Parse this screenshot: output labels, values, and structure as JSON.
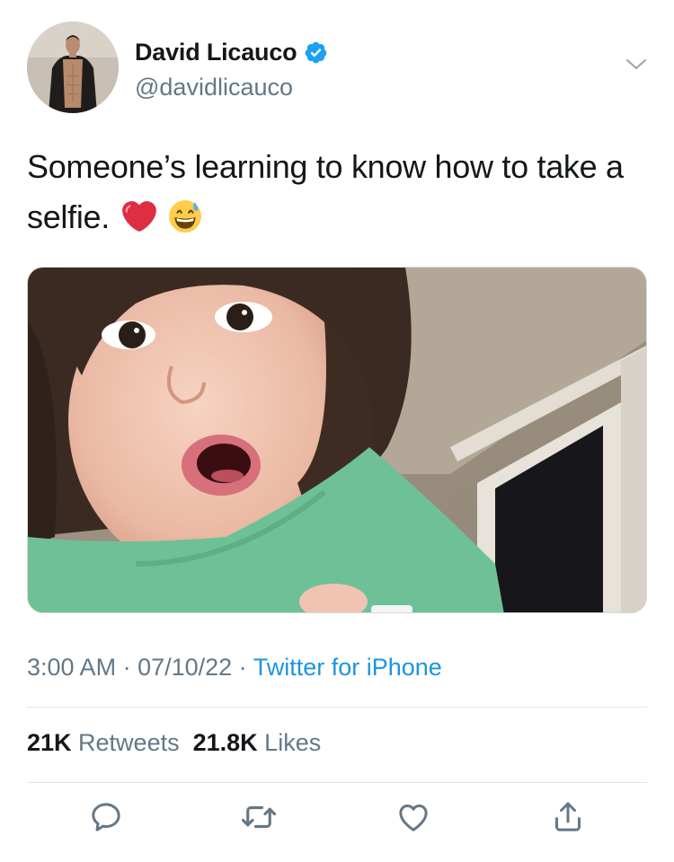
{
  "user": {
    "display_name": "David Licauco",
    "handle": "@davidlicauco",
    "verified": true
  },
  "tweet": {
    "text": "Someone’s learning to know how to take a selfie.",
    "emojis": [
      "red-heart",
      "grinning-face-with-sweat"
    ]
  },
  "meta": {
    "time": "3:00 AM",
    "sep1": " · ",
    "date": "07/10/22",
    "sep2": " · ",
    "source": "Twitter for iPhone"
  },
  "stats": {
    "retweets_count": "21K",
    "retweets_label": " Retweets",
    "likes_count": "21.8K",
    "likes_label": " Likes"
  },
  "icons": {
    "reply": "reply-icon",
    "retweet": "retweet-icon",
    "like": "heart-icon",
    "share": "share-icon"
  },
  "colors": {
    "accent": "#1b95e0",
    "verified": "#1da1f2",
    "secondary_text": "#657786",
    "primary_text": "#14171a"
  }
}
